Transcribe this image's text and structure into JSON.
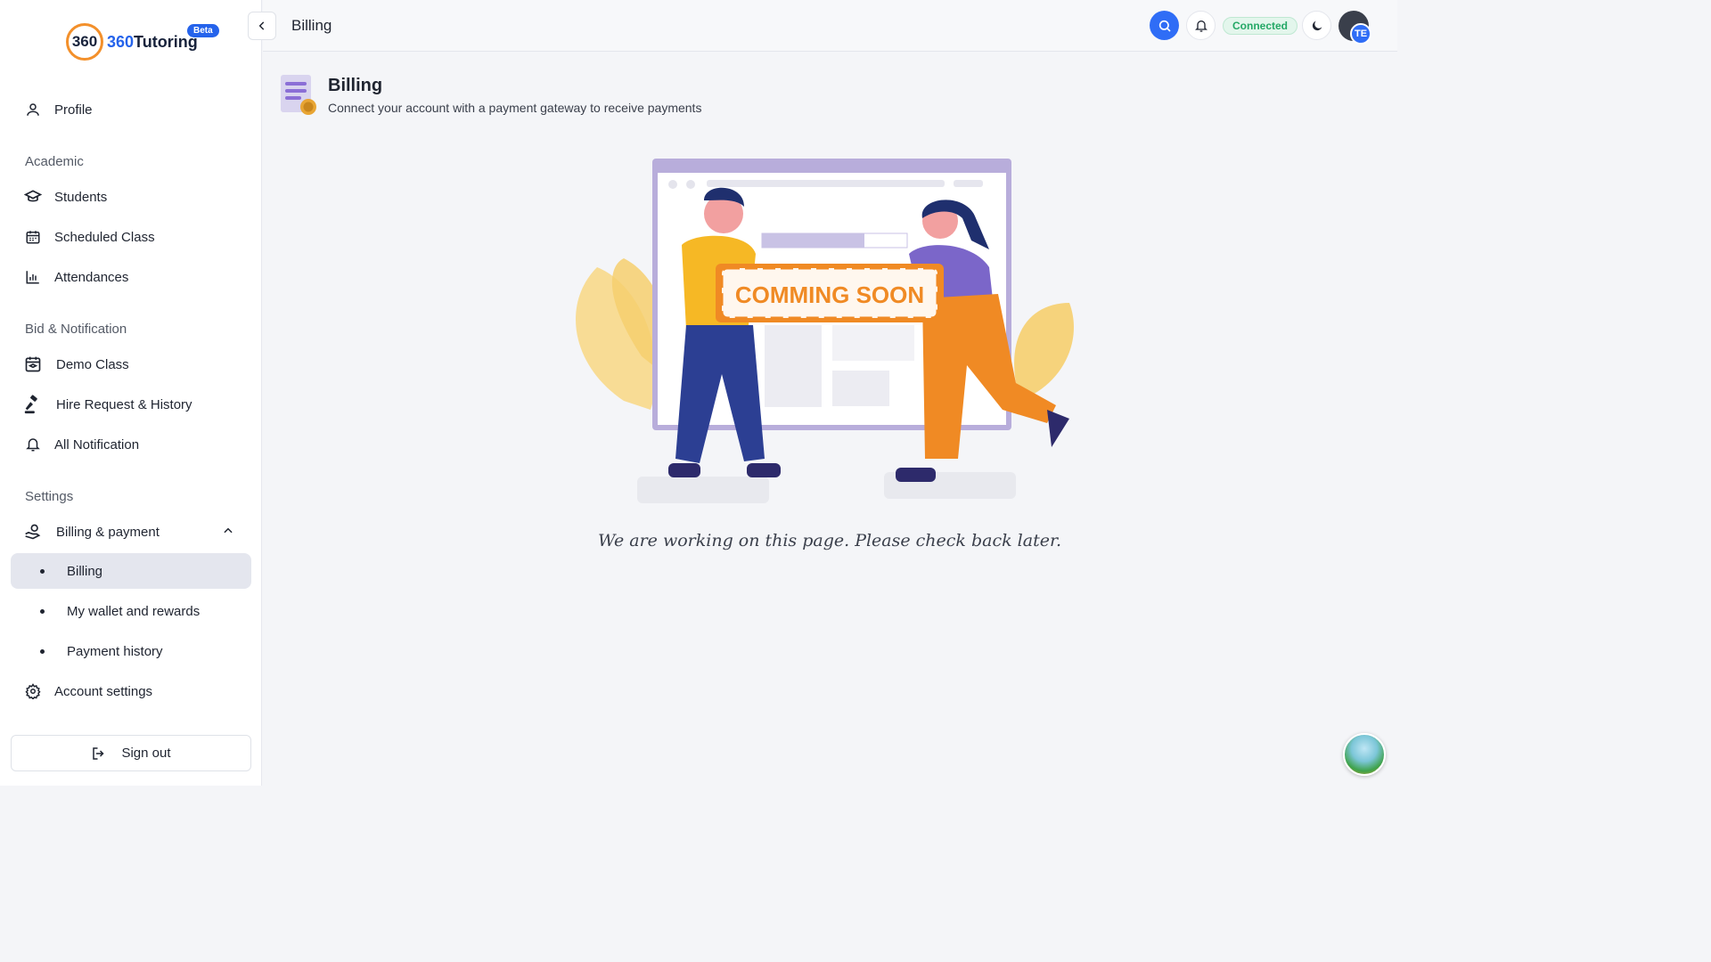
{
  "brand": {
    "name_number": "360",
    "name_text": "Tutoring",
    "badge": "360",
    "beta_label": "Beta"
  },
  "header": {
    "title": "Billing",
    "status": "Connected",
    "avatar_initials": "TE"
  },
  "sidebar": {
    "profile": "Profile",
    "sections": {
      "academic": "Academic",
      "bid_notification": "Bid & Notification",
      "settings": "Settings"
    },
    "items": {
      "students": "Students",
      "scheduled_class": "Scheduled Class",
      "attendances": "Attendances",
      "demo_class": "Demo Class",
      "hire_request": "Hire Request & History",
      "all_notification": "All Notification",
      "billing_payment": "Billing & payment",
      "billing": "Billing",
      "wallet": "My wallet and rewards",
      "payment_history": "Payment history",
      "account_settings": "Account settings"
    },
    "signout": "Sign out"
  },
  "main": {
    "title": "Billing",
    "subtitle": "Connect your account with a payment gateway to receive payments",
    "banner": "COMMING SOON",
    "message": "We are working on this page. Please check back later."
  },
  "colors": {
    "accent": "#2f6df6",
    "active_bg": "#e4e6ee",
    "status_green": "#24a866",
    "orange": "#f08a24"
  }
}
